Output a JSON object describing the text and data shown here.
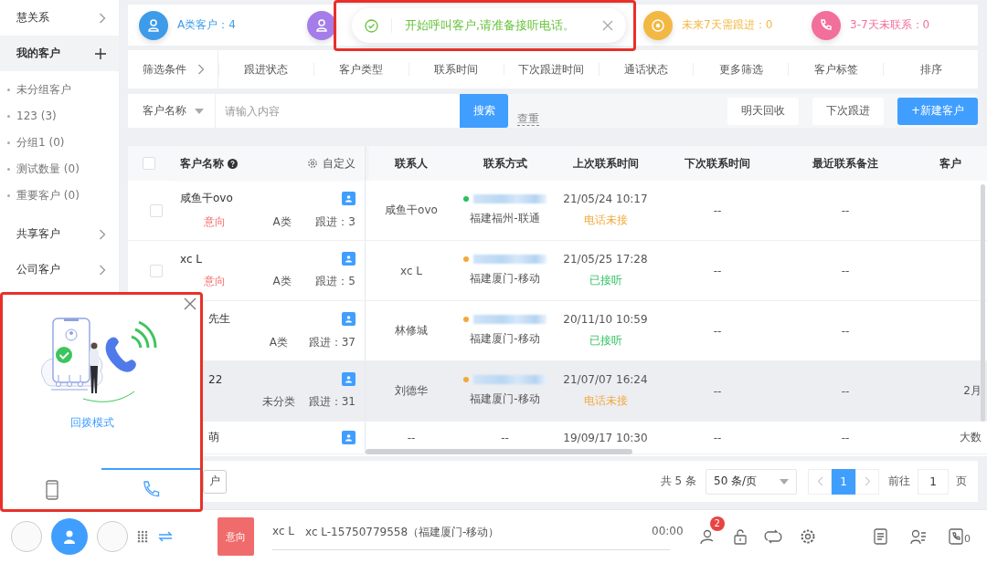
{
  "sidebar": {
    "items": [
      {
        "kind": "link",
        "label": "慧关系",
        "selected": false
      },
      {
        "kind": "add",
        "label": "我的客户",
        "selected": true,
        "children": [
          "未分组客户",
          "123 (3)",
          "分组1 (0)",
          "测试数量 (0)",
          "重要客户 (0)"
        ]
      },
      {
        "kind": "link",
        "label": "共享客户",
        "selected": false
      },
      {
        "kind": "link",
        "label": "公司客户",
        "selected": false
      }
    ]
  },
  "stats": [
    {
      "kind": "person",
      "label": "A类客户：4",
      "color": "#3d9be9"
    },
    {
      "kind": "person",
      "color": "#a57de8"
    },
    {
      "kind": "target",
      "label": "未来7天需跟进：0",
      "color": "#f2b843"
    },
    {
      "kind": "phone",
      "label": "3-7天未联系：0",
      "color": "#f36f9b"
    }
  ],
  "toast": {
    "text": "开始呼叫客户,请准备接听电话。",
    "highlighted": true
  },
  "filters": {
    "label": "筛选条件",
    "items": [
      "跟进状态",
      "客户类型",
      "联系时间",
      "下次跟进时间",
      "通话状态",
      "更多筛选",
      "客户标签",
      "排序"
    ]
  },
  "search": {
    "field": "客户名称",
    "placeholder": "请输入内容",
    "button": "搜索",
    "link": "查重",
    "actions": [
      {
        "kind": "plain",
        "label": "明天回收"
      },
      {
        "kind": "plain",
        "label": "下次跟进"
      },
      {
        "kind": "primary",
        "label": "+新建客户"
      }
    ]
  },
  "table": {
    "select_all_checked": false,
    "name_column": {
      "label": "客户名称",
      "customize": "自定义"
    },
    "columns": [
      "联系人",
      "联系方式",
      "上次联系时间",
      "下次联系时间",
      "最近联系备注",
      "客户"
    ],
    "rows": [
      {
        "checked": false,
        "highlighted": false,
        "name": "咸鱼干ovo",
        "tag": "意向",
        "category": "A类",
        "follow_ups": "跟进：3",
        "contact": "咸鱼干ovo",
        "phone": {
          "color": "#2fbf5f",
          "location": "福建福州-联通"
        },
        "last_contact": "21/05/24 10:17",
        "call_status": {
          "kind": "missed",
          "text": "电话未接"
        },
        "next_contact": "--",
        "note": "--"
      },
      {
        "checked": false,
        "highlighted": false,
        "name": "xc L",
        "tag": "意向",
        "category": "A类",
        "follow_ups": "跟进：5",
        "contact": "xc L",
        "phone": {
          "color": "#f2a93b",
          "location": "福建厦门-移动"
        },
        "last_contact": "21/05/25 17:28",
        "call_status": {
          "kind": "answered",
          "text": "已接听"
        },
        "next_contact": "--",
        "note": "--"
      },
      {
        "highlighted": false,
        "name": "先生",
        "category": "A类",
        "follow_ups": "跟进：37",
        "contact": "林修城",
        "phone": {
          "color": "#f2a93b",
          "location": "福建厦门-移动"
        },
        "last_contact": "20/11/10 10:59",
        "call_status": {
          "kind": "answered",
          "text": "已接听"
        },
        "next_contact": "--",
        "note": "--"
      },
      {
        "highlighted": true,
        "name": "22",
        "category": "未分类",
        "follow_ups": "跟进：31",
        "contact": "刘德华",
        "phone": {
          "color": "#f2a93b",
          "location": "福建厦门-移动"
        },
        "last_contact": "21/07/07 16:24",
        "call_status": {
          "kind": "missed",
          "text": "电话未接"
        },
        "next_contact": "--",
        "note": "--",
        "customer": "2月"
      },
      {
        "highlighted": false,
        "name": "萌",
        "contact": "--",
        "phone_text": "--",
        "last_contact": "19/09/17 10:30",
        "next_contact": "--",
        "note": "--",
        "customer": "大数"
      }
    ]
  },
  "pager": {
    "left_button": "户",
    "total": "共 5 条",
    "page_size": "50 条/页",
    "pages": [
      {
        "label": "1",
        "selected": true
      }
    ],
    "goto": "前往",
    "goto_value": "1",
    "unit": "页"
  },
  "popup": {
    "mode": "回拨模式",
    "highlighted": true,
    "tabs": [
      {
        "kind": "mobile",
        "selected": false
      },
      {
        "kind": "callback",
        "selected": true
      }
    ]
  },
  "callbar": {
    "tag": "意向",
    "caller": "xc L",
    "number": "xc L-15750779558（福建厦门-移动）",
    "timer": "00:00",
    "badge": "2",
    "call_count": "0"
  }
}
